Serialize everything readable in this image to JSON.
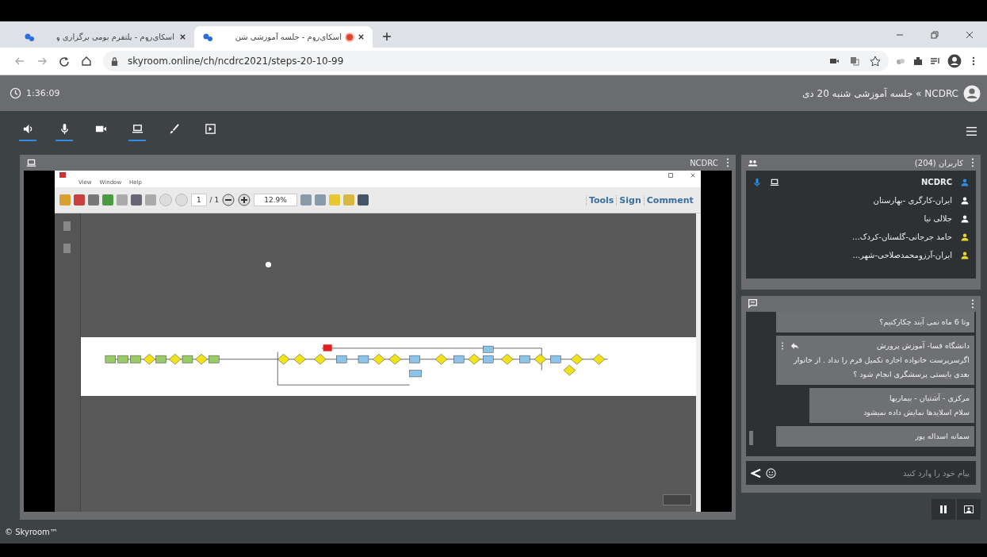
{
  "browser": {
    "tabs": [
      {
        "title": "اسکای‌روم - جلسه آموزشی شن",
        "selected": true,
        "recording": true
      },
      {
        "title": "اسکای‌روم - پلتفرم بومی برگزاری و",
        "selected": false,
        "recording": false
      }
    ],
    "url": "skyroom.online/ch/ncdrc2021/steps-20-10-99"
  },
  "header": {
    "timer": "1:36:09",
    "title": "NCDRC » جلسه آموزشی شنبه 20 دی"
  },
  "tools": [
    {
      "kind": "speaker",
      "on": true
    },
    {
      "kind": "mic",
      "on": true
    },
    {
      "kind": "camera",
      "on": false
    },
    {
      "kind": "screen",
      "on": true
    },
    {
      "kind": "brush",
      "on": false
    },
    {
      "kind": "present",
      "on": false
    }
  ],
  "share_panel": {
    "title": "NCDRC",
    "reader": {
      "menu": [
        "Help",
        "Window",
        "View"
      ],
      "page": "1",
      "page_total": "/ 1",
      "zoom": "12.9%",
      "actions": [
        "Comment",
        "Sign",
        "Tools"
      ]
    }
  },
  "users_panel": {
    "title": "کاربران (204)",
    "users": [
      {
        "name": "NCDRC",
        "color": "#2f8fe8",
        "presenter": true
      },
      {
        "name": "ایران-کارگری -بهارستان",
        "color": "#ffffff",
        "presenter": false
      },
      {
        "name": "جلالی نیا",
        "color": "#ffffff",
        "presenter": false
      },
      {
        "name": "حامد جرجانی-گلستان-کردک...",
        "color": "#e8d82c",
        "presenter": false
      },
      {
        "name": "ایران-آرزومحمدصلاحی-شهر...",
        "color": "#e8d82c",
        "presenter": false
      }
    ]
  },
  "chat_panel": {
    "messages": [
      {
        "kind": "wide",
        "text": "وتا 6 ماه نمی آیند چکارکنیم؟"
      },
      {
        "kind": "wide",
        "sender": "دانشگاه فسا- آموزش پرورش",
        "text": "اگرسرپرست خانواده اجازه تکمیل فرم را نداد . از خانوار بعدی بایستی پرسشگری انجام شود ؟",
        "actions": true
      },
      {
        "kind": "narrow",
        "sender": "مرکزی - آشتیان - بیماریها",
        "text": "سلام اسلایدها نمایش داده نمیشود"
      },
      {
        "kind": "wide",
        "sender": "سمانه اسداله پور"
      }
    ],
    "placeholder": "پیام خود را وارد کنید"
  },
  "footer": "© Skyroom™"
}
